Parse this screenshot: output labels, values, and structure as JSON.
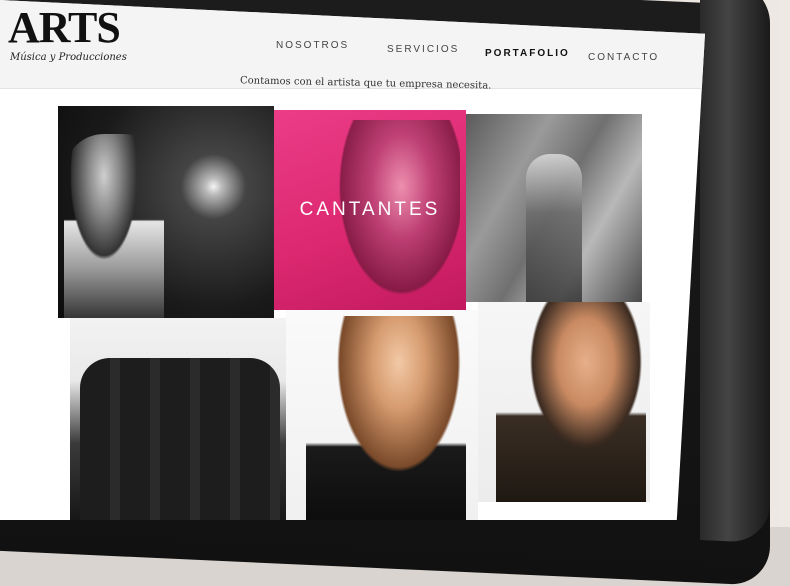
{
  "brand": {
    "logo_text": "ARTS",
    "subtitle": "Música y Producciones"
  },
  "nav": {
    "items": [
      {
        "label": "NOSOTROS",
        "active": false
      },
      {
        "label": "SERVICIOS",
        "active": false
      },
      {
        "label": "PORTAFOLIO",
        "active": true
      },
      {
        "label": "CONTACTO",
        "active": false
      }
    ]
  },
  "main": {
    "tagline": "Contamos con el artista que tu empresa necesita.",
    "tiles": [
      {
        "id": "tile-1",
        "label": ""
      },
      {
        "id": "tile-2",
        "label": "CANTANTES"
      },
      {
        "id": "tile-3",
        "label": ""
      },
      {
        "id": "tile-4",
        "label": ""
      },
      {
        "id": "tile-5",
        "label": ""
      },
      {
        "id": "tile-6",
        "label": ""
      }
    ]
  },
  "colors": {
    "accent_pink": "#e0307a",
    "header_bg": "#f4f4f4"
  }
}
